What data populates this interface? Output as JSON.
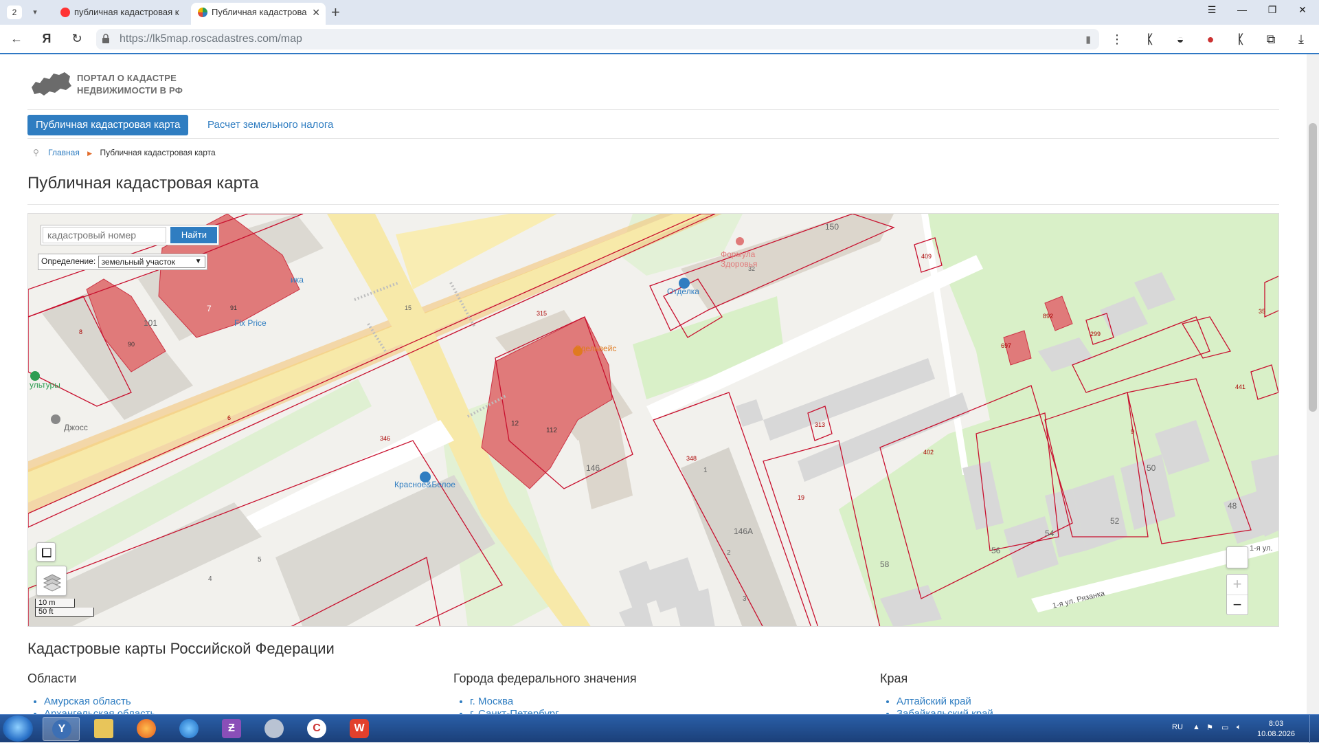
{
  "browser": {
    "tab_counter": "2",
    "tabs": [
      {
        "title": "публичная кадастровая к",
        "active": false
      },
      {
        "title": "Публичная кадастрова",
        "active": true
      }
    ],
    "url_host": "https://lk5map.roscadastres.com",
    "url_path": "/map",
    "icons": [
      "back-icon",
      "yandex-icon",
      "reload-icon",
      "lock-icon",
      "bookmark-icon",
      "menu-dots-icon",
      "download-icon"
    ]
  },
  "header": {
    "logo_line1": "ПОРТАЛ О КАДАСТРЕ",
    "logo_line2": "НЕДВИЖИМОСТИ В РФ",
    "nav": [
      {
        "label": "Публичная кадастровая карта",
        "active": true
      },
      {
        "label": "Расчет земельного налога",
        "active": false
      }
    ],
    "breadcrumbs": [
      "Главная",
      "Публичная кадастровая карта"
    ],
    "page_title": "Публичная кадастровая карта"
  },
  "map": {
    "search_placeholder": "кадастровый номер",
    "search_button": "Найти",
    "definition_label": "Определение:",
    "definition_value": "земельный участок",
    "scale_m": "10 m",
    "scale_ft": "50 ft",
    "zoom_in": "+",
    "zoom_out": "−",
    "labels": {
      "formula": "Формула",
      "zdorovya": "Здоровья",
      "otdelka": "Отделка",
      "edelweiss": "Эдельвейс",
      "fixprice": "Fix Price",
      "krasnoe": "Красное&Белое",
      "dzhoss": "Джосс",
      "kultury": "ультуры",
      "ika": "ика",
      "ryazanka": "1-я ул. Рязанка",
      "ryazanka_short": "1-я ул."
    },
    "numbers": [
      "150",
      "101",
      "146",
      "146А",
      "50",
      "48",
      "52",
      "54",
      "56",
      "58",
      "12",
      "112",
      "7",
      "91",
      "90",
      "8",
      "6",
      "9",
      "402",
      "348",
      "346",
      "19",
      "313",
      "409",
      "35",
      "441",
      "299",
      "697",
      "892",
      "315",
      "15",
      "32",
      "1",
      "2",
      "3",
      "4",
      "5"
    ]
  },
  "regions": {
    "title": "Кадастровые карты Российской Федерации",
    "columns": [
      {
        "heading": "Области",
        "items": [
          "Амурская область",
          "Архангельская область"
        ]
      },
      {
        "heading": "Города федерального значения",
        "items": [
          "г. Москва",
          "г. Санкт-Петербург"
        ]
      },
      {
        "heading": "Края",
        "items": [
          "Алтайский край",
          "Забайкальский край"
        ]
      }
    ]
  },
  "taskbar": {
    "lang": "RU",
    "time": "8:03",
    "date": "10.08.2026"
  }
}
